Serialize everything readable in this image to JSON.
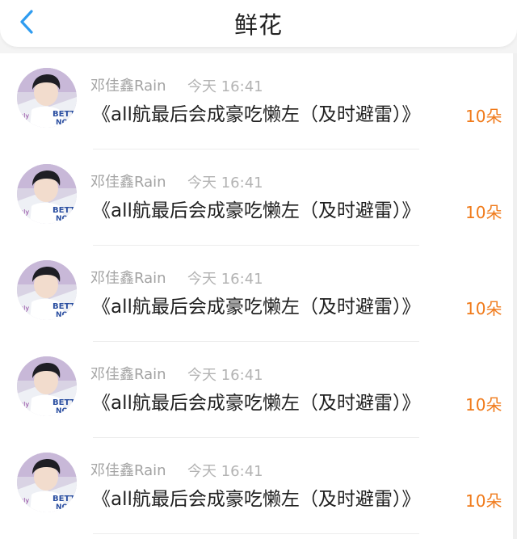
{
  "header": {
    "title": "鲜花",
    "back_icon": "chevron-left-icon",
    "accent": "#2f9cf0"
  },
  "gifts": [
    {
      "user": "邓佳鑫Rain",
      "time": "今天 16:41",
      "text": "《all航最后会成豪吃懒左（及时避雷）》",
      "count": "10朵"
    },
    {
      "user": "邓佳鑫Rain",
      "time": "今天 16:41",
      "text": "《all航最后会成豪吃懒左（及时避雷）》",
      "count": "10朵"
    },
    {
      "user": "邓佳鑫Rain",
      "time": "今天 16:41",
      "text": "《all航最后会成豪吃懒左（及时避雷）》",
      "count": "10朵"
    },
    {
      "user": "邓佳鑫Rain",
      "time": "今天 16:41",
      "text": "《all航最后会成豪吃懒左（及时避雷）》",
      "count": "10朵"
    },
    {
      "user": "邓佳鑫Rain",
      "time": "今天 16:41",
      "text": "《all航最后会成豪吃懒左（及时避雷）》",
      "count": "10朵"
    }
  ],
  "colors": {
    "count": "#f07a1a",
    "name": "#a3a3a3",
    "text": "#202020"
  }
}
